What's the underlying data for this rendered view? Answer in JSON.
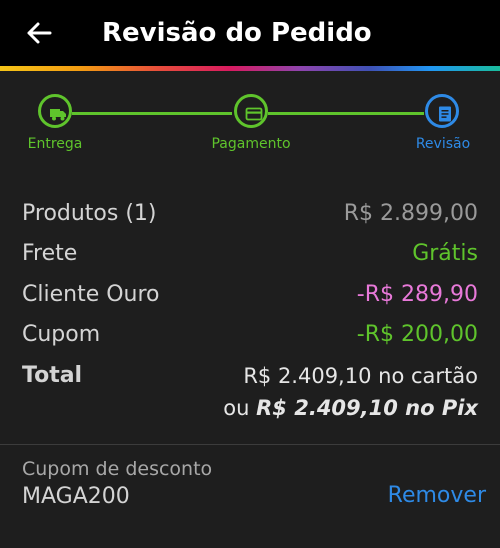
{
  "header": {
    "title": "Revisão do Pedido",
    "back_icon": "arrow-left-icon"
  },
  "colors": {
    "header_bg": "#000000",
    "page_bg": "#1e1e1e",
    "completed_step": "#5fc42c",
    "current_step": "#2e8ae6",
    "free_green": "#5fc42c",
    "gold_discount": "#e879d9",
    "link_blue": "#2e8ae6"
  },
  "stepper": {
    "steps": [
      {
        "label": "Entrega",
        "icon": "truck-icon",
        "state": "completed"
      },
      {
        "label": "Pagamento",
        "icon": "credit-card-icon",
        "state": "completed"
      },
      {
        "label": "Revisão",
        "icon": "document-icon",
        "state": "current"
      }
    ]
  },
  "summary": {
    "products_label": "Produtos (1)",
    "products_value": "R$ 2.899,00",
    "shipping_label": "Frete",
    "shipping_value": "Grátis",
    "gold_label": "Cliente Ouro",
    "gold_value": "-R$ 289,90",
    "coupon_label": "Cupom",
    "coupon_value": "-R$ 200,00",
    "total_label": "Total",
    "total_card_value": "R$ 2.409,10",
    "total_card_suffix": "no cartão",
    "total_pix_prefix": "ou",
    "total_pix_value": "R$ 2.409,10 no Pix"
  },
  "coupon": {
    "label": "Cupom de desconto",
    "code": "MAGA200",
    "remove_label": "Remover"
  }
}
